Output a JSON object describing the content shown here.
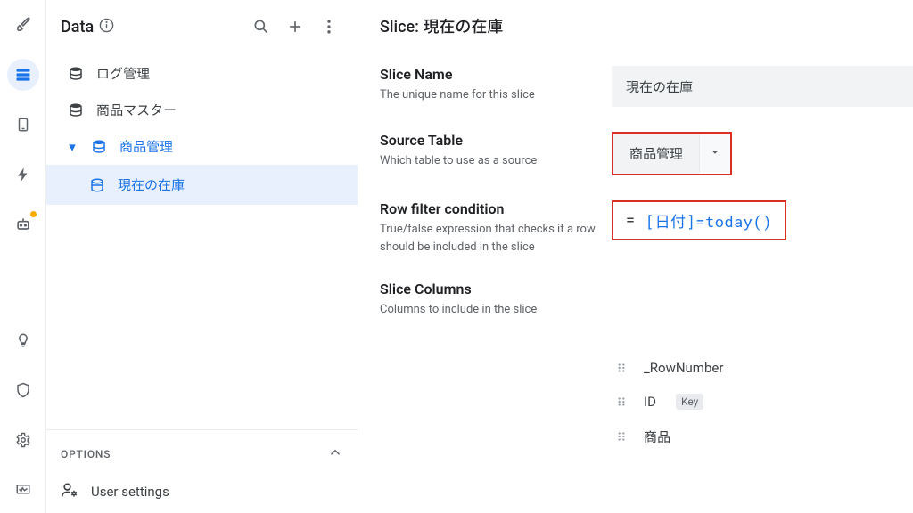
{
  "sidebar": {
    "title": "Data",
    "items": [
      {
        "label": "ログ管理"
      },
      {
        "label": "商品マスター"
      },
      {
        "label": "商品管理",
        "group": true,
        "children": [
          {
            "label": "現在の在庫",
            "selected": true
          }
        ]
      }
    ],
    "options": {
      "title": "OPTIONS",
      "rows": [
        {
          "label": "User settings"
        }
      ]
    }
  },
  "main": {
    "title_prefix": "Slice: ",
    "title_value": "現在の在庫",
    "fields": {
      "slice_name": {
        "label": "Slice Name",
        "desc": "The unique name for this slice",
        "value": "現在の在庫"
      },
      "source_table": {
        "label": "Source Table",
        "desc": "Which table to use as a source",
        "value": "商品管理"
      },
      "row_filter": {
        "label": "Row filter condition",
        "desc": "True/false expression that checks if a row should be included in the slice",
        "value": "[日付]=today()"
      },
      "slice_columns": {
        "label": "Slice Columns",
        "desc": "Columns to include in the slice"
      }
    },
    "columns": [
      {
        "label": "_RowNumber",
        "key": false
      },
      {
        "label": "ID",
        "key": true
      },
      {
        "label": "商品",
        "key": false
      }
    ],
    "key_badge": "Key"
  }
}
